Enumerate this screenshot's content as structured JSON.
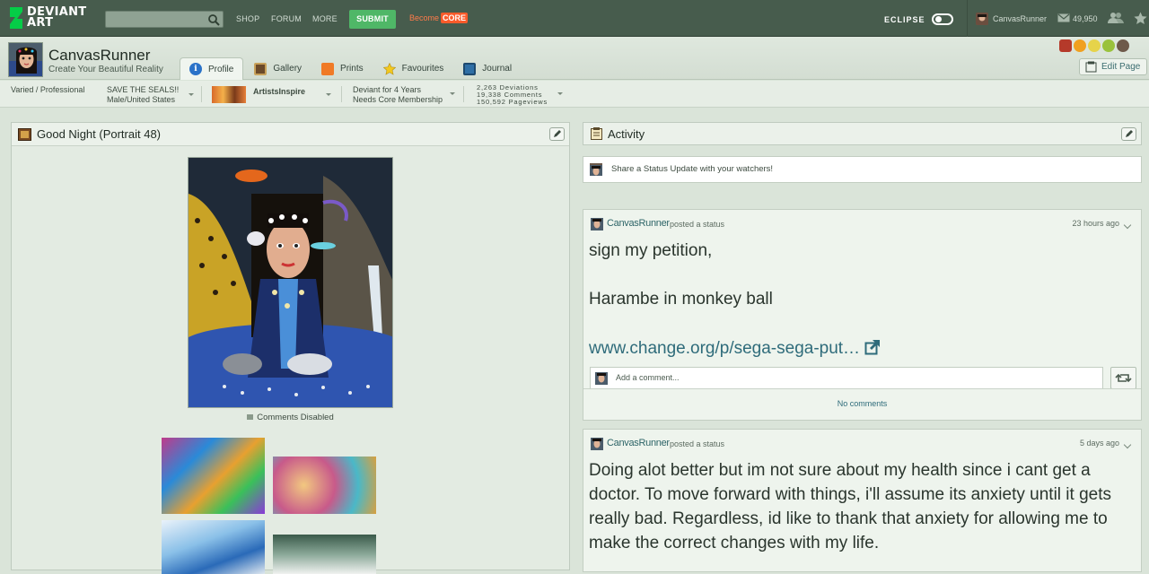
{
  "topbar": {
    "logo_line1": "DEVIANT",
    "logo_line2": "ART",
    "search_placeholder": "",
    "nav": [
      "SHOP",
      "FORUM",
      "MORE"
    ],
    "submit_label": "SUBMIT",
    "become_label": "Become",
    "core_label": "CORE",
    "eclipse_label": "ECLIPSE",
    "username": "CanvasRunner",
    "message_count": "49,950"
  },
  "profile": {
    "username": "CanvasRunner",
    "tagline": "Create Your Beautiful Reality",
    "tabs": [
      {
        "label": "Profile",
        "active": true
      },
      {
        "label": "Gallery"
      },
      {
        "label": "Prints"
      },
      {
        "label": "Favourites"
      },
      {
        "label": "Journal"
      }
    ],
    "edit_page_label": "Edit Page"
  },
  "infobar": {
    "type": "Varied / Professional",
    "cause": "SAVE THE SEALS!!",
    "location": "Male/United States",
    "group": "ArtistsInspire",
    "member_since": "Deviant for 4 Years",
    "membership": "Needs Core Membership",
    "stats": {
      "deviations": "2,263 Deviations",
      "comments": "19,338 Comments",
      "pageviews": "150,592 Pageviews"
    }
  },
  "featured": {
    "title": "Good Night (Portrait 48)",
    "comments_disabled": "Comments Disabled"
  },
  "activity": {
    "title": "Activity",
    "status_prompt": "Share a Status Update with your watchers!",
    "posts": [
      {
        "user": "CanvasRunner",
        "action": "posted a status",
        "time": "23 hours ago",
        "line1": "sign my petition,",
        "line2": "Harambe in monkey ball",
        "link": "www.change.org/p/sega-sega-put…",
        "comment_placeholder": "Add a comment...",
        "no_comments": "No comments"
      },
      {
        "user": "CanvasRunner",
        "action": "posted a status",
        "time": "5 days ago",
        "lines": [
          "Doing alot better but im not sure about my health since i cant get a",
          "doctor. To move forward with things, i'll assume its anxiety until it gets",
          "really bad. Regardless, id like to thank that anxiety for allowing me to",
          "make the correct changes with my life."
        ]
      }
    ]
  },
  "colors": {
    "topbar_bg": "#475c4d",
    "submit_green": "#4fb767",
    "core_orange": "#fb5b2b",
    "link_teal": "#2e6568"
  }
}
